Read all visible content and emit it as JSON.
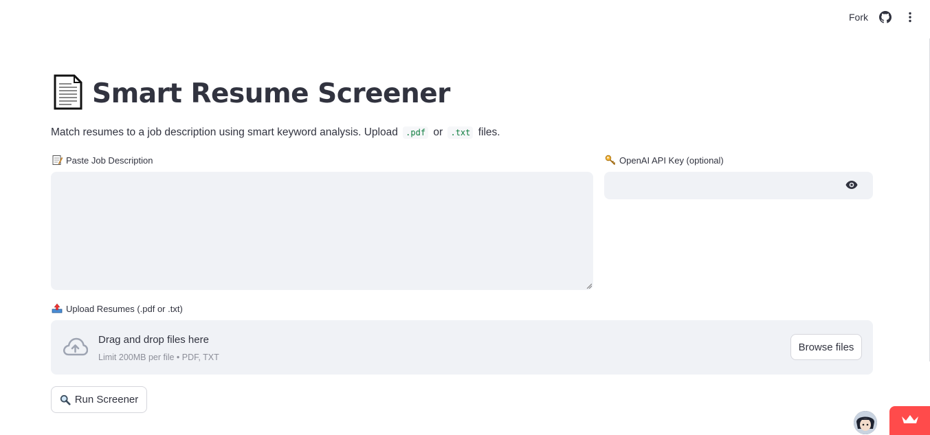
{
  "toolbar": {
    "fork_label": "Fork",
    "icons": [
      "github-icon",
      "more-vert-icon"
    ]
  },
  "header": {
    "title": "Smart Resume Screener",
    "title_icon": "page-document-icon"
  },
  "intro": {
    "text_before": "Match resumes to a job description using smart keyword analysis. Upload",
    "code_pdf": ".pdf",
    "text_or": "or",
    "code_txt": ".txt",
    "text_after": "files."
  },
  "job_description": {
    "label": "Paste Job Description",
    "icon": "memo-icon",
    "value": ""
  },
  "api_key": {
    "label": "OpenAI API Key (optional)",
    "icon": "key-icon",
    "value": "",
    "toggle_icon": "eye-icon"
  },
  "uploader": {
    "label": "Upload Resumes (.pdf or .txt)",
    "icon": "outbox-tray-icon",
    "drop_title": "Drag and drop files here",
    "limit_text": "Limit 200MB per file • PDF, TXT",
    "browse_label": "Browse files"
  },
  "run_button": {
    "label": "Run Screener",
    "icon": "magnifier-icon"
  },
  "colors": {
    "accent": "#ff4b4b",
    "input_bg": "#f0f2f6",
    "text": "#31333f",
    "code_green": "#0f7d3f"
  }
}
